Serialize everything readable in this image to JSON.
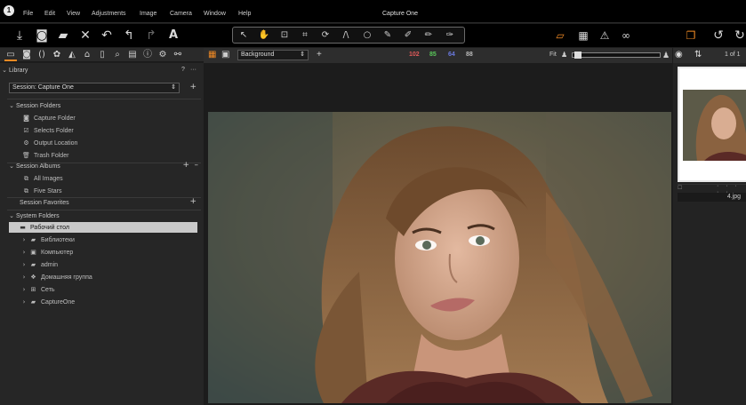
{
  "app": {
    "title": "Capture One"
  },
  "menu": [
    "File",
    "Edit",
    "View",
    "Adjustments",
    "Image",
    "Camera",
    "Window",
    "Help"
  ],
  "toolbar": {
    "left_icons": [
      "import-icon",
      "camera-icon",
      "folder-icon",
      "delete-icon",
      "undo-all-icon",
      "undo-icon",
      "redo-icon",
      "text-icon"
    ],
    "cursor_tools": [
      "select-icon",
      "pan-icon",
      "loupe-icon",
      "crop-icon",
      "rotate-icon",
      "keystone-icon",
      "circle-icon",
      "brush-icon",
      "eraser-icon",
      "gradient-icon",
      "clone-icon"
    ],
    "right_icons": [
      "exposure-warning-icon",
      "grid-icon",
      "warning-icon",
      "proof-icon",
      "copy-apply-icon",
      "reset-icon",
      "rotate-icon"
    ]
  },
  "viewer": {
    "background_label": "Background",
    "histogram": [
      "102",
      "85",
      "64",
      "88"
    ],
    "fit_label": "Fit",
    "page_label": "1 of 1"
  },
  "library": {
    "title": "Library",
    "help": "?",
    "more": "···",
    "session_label": "Session: Capture One",
    "session_folders_header": "Session Folders",
    "session_folders": [
      "Capture Folder",
      "Selects Folder",
      "Output Location",
      "Trash Folder"
    ],
    "session_albums_header": "Session Albums",
    "session_albums": [
      "All Images",
      "Five Stars"
    ],
    "session_favorites_header": "Session Favorites",
    "system_folders_header": "System Folders",
    "system_folders": [
      "Рабочий стол",
      "Библиотеки",
      "Компьютер",
      "admin",
      "Домашняя группа",
      "Сеть",
      "CaptureOne"
    ]
  },
  "browser": {
    "filename": "4.jpg"
  },
  "colors": {
    "accent": "#f08a24",
    "hist_red": "#e05a5a",
    "hist_green": "#5ac85a",
    "hist_blue": "#6a7ae0",
    "hist_gray": "#bbbbbb"
  }
}
